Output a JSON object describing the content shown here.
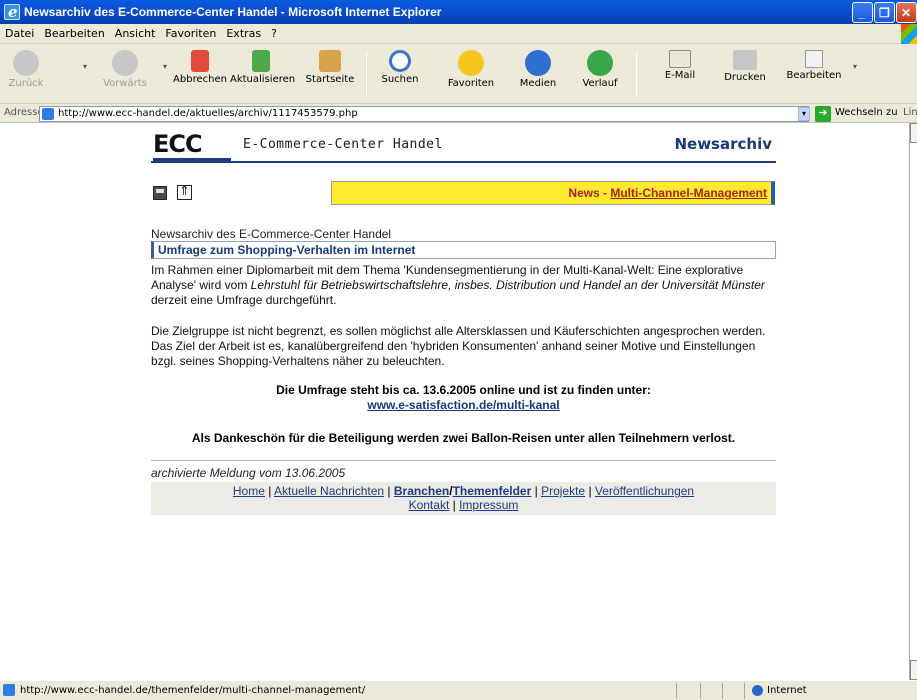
{
  "window": {
    "title": "Newsarchiv des E-Commerce-Center Handel - Microsoft Internet Explorer",
    "minimize": "_",
    "restore": "❐",
    "close": "✕"
  },
  "menu": [
    "Datei",
    "Bearbeiten",
    "Ansicht",
    "Favoriten",
    "Extras",
    "?"
  ],
  "toolbar": {
    "back": "Zurück",
    "forward": "Vorwärts",
    "stop": "Abbrechen",
    "refresh": "Aktualisieren",
    "home": "Startseite",
    "search": "Suchen",
    "favorites": "Favoriten",
    "media": "Medien",
    "history": "Verlauf",
    "mail": "E-Mail",
    "print": "Drucken",
    "edit": "Bearbeiten"
  },
  "address": {
    "label": "Adresse",
    "url": "http://www.ecc-handel.de/aktuelles/archiv/1117453579.php",
    "go": "Wechseln zu",
    "links": "Links"
  },
  "header": {
    "logo": "ECC",
    "site_name": "E-Commerce-Center Handel",
    "section": "Newsarchiv"
  },
  "news_bar": {
    "prefix": "News - ",
    "link": "Multi-Channel-Management"
  },
  "article": {
    "archive_title": "Newsarchiv des E-Commerce-Center Handel",
    "headline": "Umfrage zum Shopping-Verhalten im Internet",
    "p1_a": "Im Rahmen einer Diplomarbeit mit dem Thema 'Kundensegmentierung in der Multi-Kanal-Welt: Eine explorative Analyse' wird vom ",
    "p1_em": "Lehrstuhl für Betriebswirtschaftslehre, insbes. Distribution und Handel an der Universität Münster",
    "p1_b": " derzeit eine Umfrage durchgeführt.",
    "p2": "Die Zielgruppe ist nicht begrenzt, es sollen möglichst alle Altersklassen und Käuferschichten angesprochen werden. Das Ziel der Arbeit ist es, kanalübergreifend den 'hybriden Konsumenten' anhand seiner Motive und Einstellungen bzgl. seines Shopping-Verhaltens näher zu beleuchten.",
    "online_line": "Die Umfrage steht bis ca. 13.6.2005 online und ist zu finden unter:",
    "survey_link": "www.e-satisfaction.de/multi-kanal",
    "thanks": "Als Dankeschön für die Beteiligung werden zwei Ballon-Reisen unter allen Teilnehmern verlost.",
    "archived_note": "archivierte Meldung vom 13.06.2005"
  },
  "footer": {
    "sep": " | ",
    "home": "Home",
    "news": "Aktuelle Nachrichten",
    "branchen": "Branchen",
    "slash": "/",
    "themen": "Themenfelder",
    "projekte": "Projekte",
    "publications": "Veröffentlichungen",
    "contact": "Kontakt",
    "imprint": "Impressum"
  },
  "status": {
    "url": "http://www.ecc-handel.de/themenfelder/multi-channel-management/",
    "zone": "Internet"
  }
}
